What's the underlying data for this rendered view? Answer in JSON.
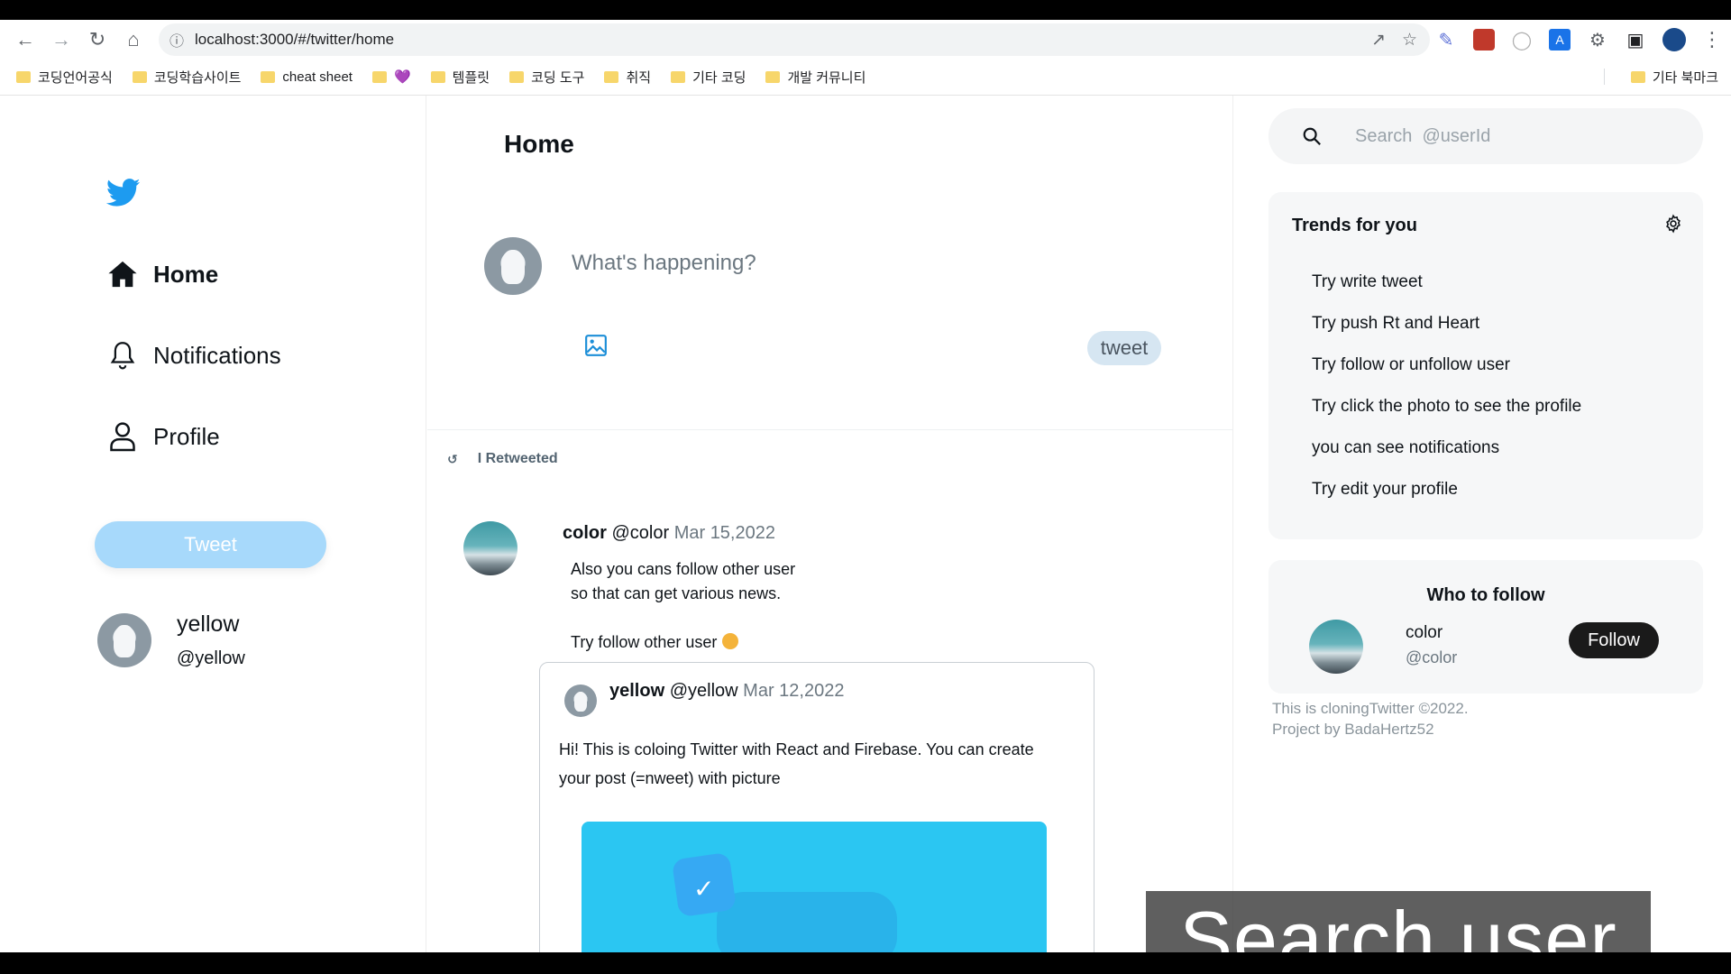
{
  "browser": {
    "url": "localhost:3000/#/twitter/home",
    "bookmarks": [
      "코딩언어공식",
      "코딩학습사이트",
      "cheat sheet",
      "💜",
      "템플릿",
      "코딩 도구",
      "취직",
      "기타 코딩",
      "개발 커뮤니티"
    ],
    "other_bookmarks": "기타 북마크"
  },
  "sidebar": {
    "items": [
      {
        "label": "Home",
        "icon": "home-icon"
      },
      {
        "label": "Notifications",
        "icon": "bell-icon"
      },
      {
        "label": "Profile",
        "icon": "user-icon"
      }
    ],
    "tweet_button": "Tweet",
    "user": {
      "name": "yellow",
      "handle": "@yellow"
    }
  },
  "main": {
    "title": "Home",
    "compose": {
      "placeholder": "What's happening?",
      "tweet_button": "tweet"
    },
    "retweet_label": "I Retweeted",
    "tweet": {
      "name": "color",
      "handle": "@color",
      "date": "Mar 15,2022",
      "text": "Also you cans follow other user\nso that can get various news.\n\nTry follow other user",
      "quote": {
        "name": "yellow",
        "handle": "@yellow",
        "date": "Mar 12,2022",
        "text": "Hi! This is coloing Twitter with React and Firebase. You can create your post (=nweet) with picture"
      }
    }
  },
  "right": {
    "search_placeholder": "Search  @userId",
    "trends": {
      "title": "Trends for you",
      "items": [
        "Try write tweet",
        "Try push Rt and Heart",
        "Try follow or unfollow user",
        "Try click the photo to see the profile",
        "you can see notifications",
        "Try edit your profile"
      ]
    },
    "who_to_follow": {
      "title": "Who to follow",
      "name": "color",
      "handle": "@color",
      "button": "Follow"
    },
    "footer": "This is cloningTwitter  ©2022.\nProject  by  BadaHertz52"
  },
  "caption": "Search user",
  "colors": {
    "accent": "#1d9bf0",
    "tweet_button": "#a7d9fb",
    "follow_button": "#1a1a1a"
  }
}
